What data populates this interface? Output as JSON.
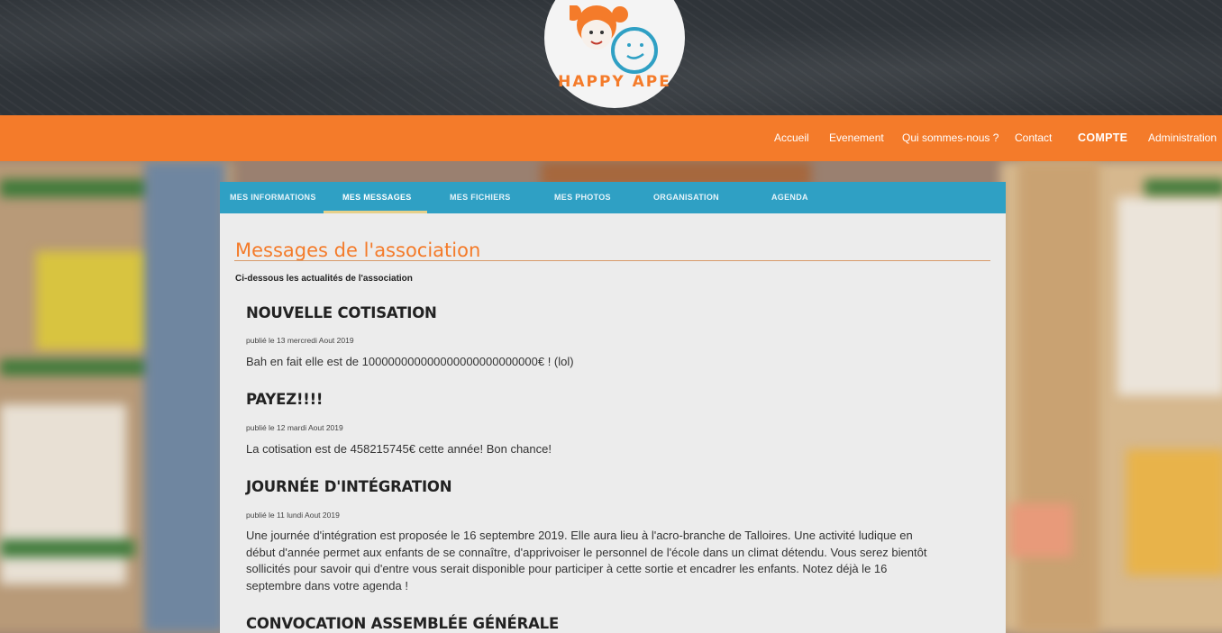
{
  "header": {
    "logo_text": "HAPPY APE"
  },
  "nav": {
    "items": [
      {
        "label": "Accueil"
      },
      {
        "label": "Evenement"
      },
      {
        "label": "Qui sommes-nous ?"
      },
      {
        "label": "Contact"
      },
      {
        "label": "COMPTE"
      },
      {
        "label": "Administration"
      }
    ]
  },
  "tabs": [
    {
      "label": "MES INFORMATIONS"
    },
    {
      "label": "MES MESSAGES",
      "active": true
    },
    {
      "label": "MES FICHIERS"
    },
    {
      "label": "MES PHOTOS"
    },
    {
      "label": "ORGANISATION"
    },
    {
      "label": "AGENDA"
    }
  ],
  "page": {
    "title": "Messages de l'association",
    "subtitle": "Ci-dessous les actualités de l'association"
  },
  "messages": [
    {
      "title": "NOUVELLE COTISATION",
      "date": "publié le 13 mercredi Aout 2019",
      "body": "Bah en fait elle est de 100000000000000000000000000€ ! (lol)"
    },
    {
      "title": "PAYEZ!!!!",
      "date": "publié le 12 mardi Aout 2019",
      "body": "La cotisation est de 458215745€ cette année! Bon chance!"
    },
    {
      "title": "JOURNÉE D'INTÉGRATION",
      "date": "publié le 11 lundi Aout 2019",
      "body": "Une journée d'intégration est proposée le 16 septembre 2019. Elle aura lieu à l'acro-branche de Talloires. Une activité ludique en début d'année permet aux enfants de se connaître, d'apprivoiser le personnel de l'école dans un climat détendu. Vous serez bientôt sollicités pour savoir qui d'entre vous serait disponible pour participer à cette sortie et encadrer les enfants. Notez déjà le 16 septembre dans votre agenda !"
    },
    {
      "title": "CONVOCATION ASSEMBLÉE GÉNÉRALE"
    }
  ],
  "colors": {
    "accent": "#f47b2a",
    "tab_bar": "#2fa0c4",
    "header_bg": "#2f3439",
    "panel_bg": "#ececec"
  }
}
